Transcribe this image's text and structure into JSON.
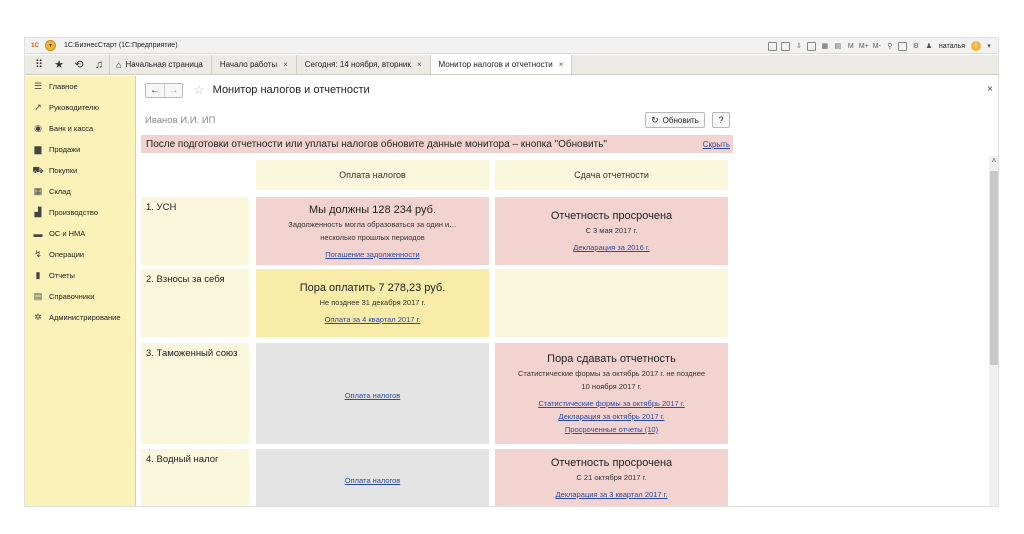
{
  "app": {
    "title": "1С:БизнесСтарт (1С:Предприятие)",
    "logo": "1С",
    "user": "наталья",
    "toolbar_icons": [
      "print-icon",
      "save-icon",
      "download-icon",
      "upload-icon",
      "calculator-icon",
      "calendar-icon",
      "search-icon",
      "window-icon",
      "settings-icon",
      "info-icon"
    ],
    "memory_buttons": [
      "M",
      "M+",
      "M-"
    ]
  },
  "tabs": {
    "home": "Начальная страница",
    "items": [
      {
        "label": "Начало работы"
      },
      {
        "label": "Сегодня: 14 ноября, вторник"
      },
      {
        "label": "Монитор налогов и отчетности"
      }
    ]
  },
  "sidebar": {
    "items": [
      {
        "label": "Главное",
        "icon": "menu-icon",
        "glyph": "☰"
      },
      {
        "label": "Руководителю",
        "icon": "chart-line-icon",
        "glyph": "↗"
      },
      {
        "label": "Банк и касса",
        "icon": "bank-icon",
        "glyph": "◉"
      },
      {
        "label": "Продажи",
        "icon": "bag-icon",
        "glyph": "▆"
      },
      {
        "label": "Покупки",
        "icon": "cart-icon",
        "glyph": "⛟"
      },
      {
        "label": "Склад",
        "icon": "warehouse-icon",
        "glyph": "▦"
      },
      {
        "label": "Производство",
        "icon": "factory-icon",
        "glyph": "▟"
      },
      {
        "label": "ОС и НМА",
        "icon": "truck-icon",
        "glyph": "▬"
      },
      {
        "label": "Операции",
        "icon": "operations-icon",
        "glyph": "↯"
      },
      {
        "label": "Отчеты",
        "icon": "report-icon",
        "glyph": "▮"
      },
      {
        "label": "Справочники",
        "icon": "book-icon",
        "glyph": "▤"
      },
      {
        "label": "Администрирование",
        "icon": "gear-icon",
        "glyph": "✲"
      }
    ]
  },
  "form": {
    "title": "Монитор налогов и отчетности",
    "org": "Иванов И.И. ИП",
    "refresh_label": "Обновить",
    "help_label": "?",
    "notice": "После подготовки отчетности или уплаты налогов обновите данные монитора – кнопка \"Обновить\"",
    "notice_hide": "Скрыть",
    "col_payment": "Оплата налогов",
    "col_reporting": "Сдача отчетности"
  },
  "rows": [
    {
      "label": "1. УСН",
      "pay": {
        "title": "Мы должны 128 234 руб.",
        "sub": "Задолженность могла образоваться за один и…",
        "sub2": "несколько прошлых периодов",
        "link": "Погашение задолженности"
      },
      "rep": {
        "title": "Отчетность просрочена",
        "sub": "С 3 мая 2017 г.",
        "link": "Декларация за 2016 г."
      }
    },
    {
      "label": "2. Взносы за себя",
      "pay": {
        "title": "Пора оплатить 7 278,23 руб.",
        "sub": "Не позднее 31 декабря 2017 г.",
        "link": "Оплата за 4 квартал 2017 г."
      }
    },
    {
      "label": "3. Таможенный союз",
      "pay": {
        "link": "Оплата налогов"
      },
      "rep": {
        "title": "Пора сдавать отчетность",
        "sub": "Статистические формы за октябрь 2017 г. не позднее",
        "sub2": "10 ноября 2017 г.",
        "link": "Статистические формы за октябрь 2017 г.",
        "link2": "Декларация за октябрь 2017 г.",
        "link3": "Просроченные отчеты (10)"
      }
    },
    {
      "label": "4. Водный налог",
      "pay": {
        "link": "Оплата налогов"
      },
      "rep": {
        "title": "Отчетность просрочена",
        "sub": "С 21 октября 2017 г.",
        "link": "Декларация за 3 квартал 2017 г."
      }
    }
  ]
}
